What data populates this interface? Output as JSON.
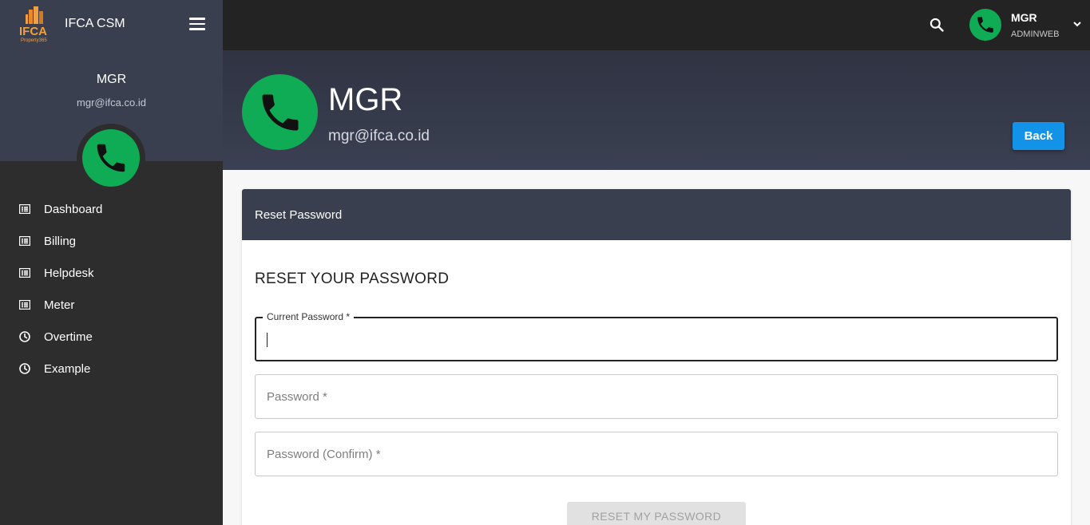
{
  "app": {
    "brand_name": "IFCA CSM",
    "logo_text": "IFCA",
    "logo_subtext": "Property365"
  },
  "sidebar": {
    "user_name": "MGR",
    "user_email": "mgr@ifca.co.id",
    "items": [
      {
        "label": "Dashboard",
        "icon": "list-icon"
      },
      {
        "label": "Billing",
        "icon": "list-icon"
      },
      {
        "label": "Helpdesk",
        "icon": "list-icon"
      },
      {
        "label": "Meter",
        "icon": "list-icon"
      },
      {
        "label": "Overtime",
        "icon": "clock-icon"
      },
      {
        "label": "Example",
        "icon": "clock-icon"
      }
    ]
  },
  "topbar": {
    "user_name": "MGR",
    "user_role": "ADMINWEB"
  },
  "profile": {
    "name": "MGR",
    "email": "mgr@ifca.co.id",
    "back_label": "Back"
  },
  "card": {
    "header": "Reset Password",
    "title": "RESET YOUR PASSWORD",
    "fields": {
      "current_password_label": "Current Password *",
      "password_placeholder": "Password *",
      "password_confirm_placeholder": "Password (Confirm) *"
    },
    "submit_label": "RESET MY PASSWORD"
  },
  "colors": {
    "avatar_green": "#0fac55",
    "back_blue": "#1393e8",
    "header_dark": "#3a3f50"
  }
}
